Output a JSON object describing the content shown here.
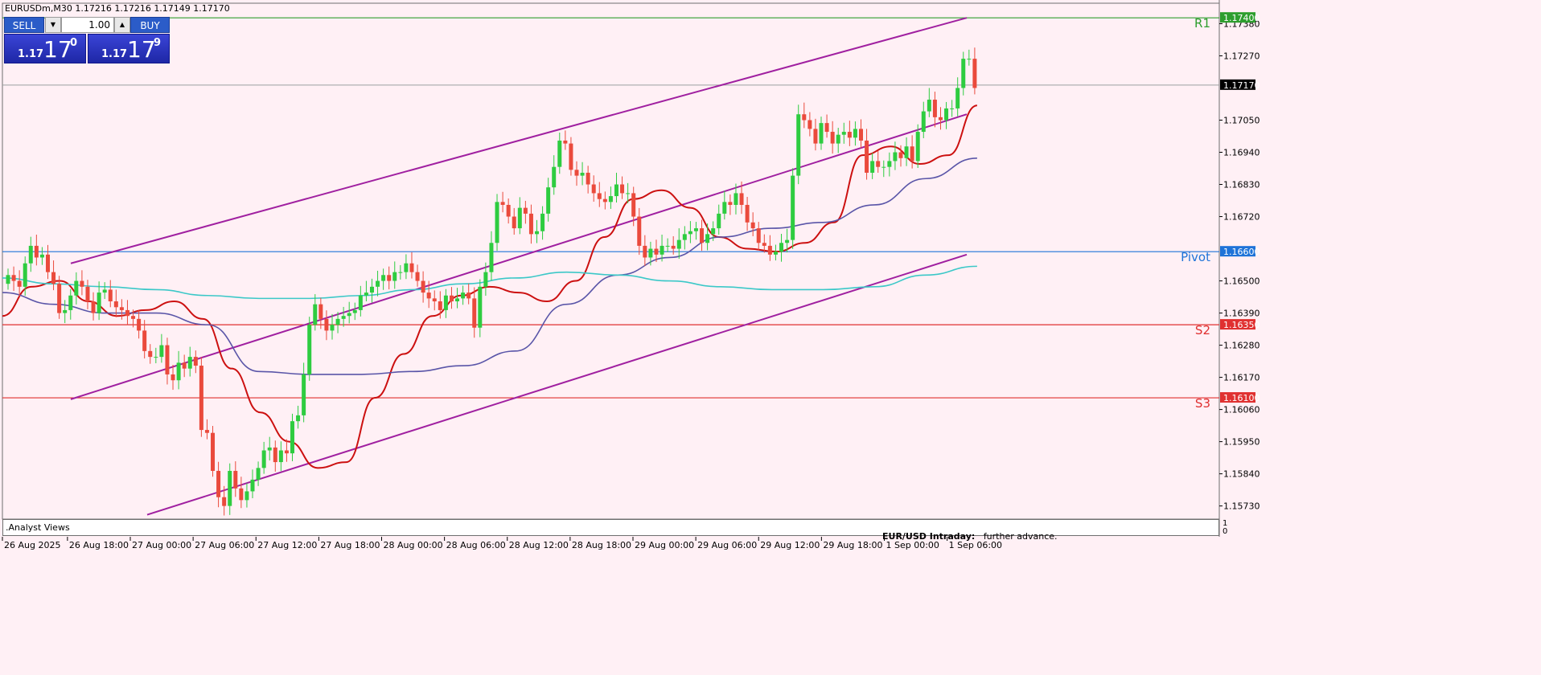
{
  "window": {
    "title": "EURUSDm,M30  1.17216 1.17216 1.17149 1.17170"
  },
  "trade_panel": {
    "sell_label": "SELL",
    "buy_label": "BUY",
    "lot_value": "1.00",
    "sell_price_small": "1.17",
    "sell_price_big": "17",
    "sell_price_sup": "0",
    "buy_price_small": "1.17",
    "buy_price_big": "17",
    "buy_price_sup": "9",
    "sell_color": "#2b5cc8",
    "quote_color": "#2a35c0"
  },
  "subwindow": {
    "label": ".Analyst Views",
    "scale_top": "1",
    "scale_bottom": "0",
    "news_title": "EUR/USD Intraday:",
    "news_text": "further advance."
  },
  "chart_data": {
    "type": "candlestick",
    "symbol": "EURUSDm",
    "timeframe": "M30",
    "ylim": [
      1.1568,
      1.1745
    ],
    "y_ticks": [
      "1.17380",
      "1.17270",
      "1.17050",
      "1.16940",
      "1.16830",
      "1.16720",
      "1.16500",
      "1.16390",
      "1.16280",
      "1.16170",
      "1.16060",
      "1.15950",
      "1.15840",
      "1.15730"
    ],
    "x_ticks": [
      "26 Aug 2025",
      "26 Aug 18:00",
      "27 Aug 00:00",
      "27 Aug 06:00",
      "27 Aug 12:00",
      "27 Aug 18:00",
      "28 Aug 00:00",
      "28 Aug 06:00",
      "28 Aug 12:00",
      "28 Aug 18:00",
      "29 Aug 00:00",
      "29 Aug 06:00",
      "29 Aug 12:00",
      "29 Aug 18:00",
      "1 Sep 00:00",
      "1 Sep 06:00"
    ],
    "levels": [
      {
        "name": "R1",
        "value": 1.174,
        "tag": "1.17400",
        "color": "#2e9e2e"
      },
      {
        "name": "Pivot",
        "value": 1.166,
        "tag": "1.16600",
        "color": "#1e73d8"
      },
      {
        "name": "S2",
        "value": 1.1635,
        "tag": "1.16350",
        "color": "#e03030"
      },
      {
        "name": "S3",
        "value": 1.161,
        "tag": "1.16100",
        "color": "#e03030"
      }
    ],
    "bid": {
      "value": 1.1717,
      "tag": "1.17170"
    },
    "close": [
      1.1652,
      1.165,
      1.1648,
      1.1656,
      1.1662,
      1.1658,
      1.1659,
      1.1653,
      1.1649,
      1.1639,
      1.164,
      1.1645,
      1.165,
      1.1648,
      1.1643,
      1.1639,
      1.1646,
      1.1647,
      1.1643,
      1.1641,
      1.164,
      1.1638,
      1.1637,
      1.1633,
      1.1626,
      1.1624,
      1.1624,
      1.1628,
      1.1618,
      1.1616,
      1.1622,
      1.162,
      1.1624,
      1.1621,
      1.1599,
      1.1598,
      1.1585,
      1.1576,
      1.1573,
      1.1585,
      1.1579,
      1.1575,
      1.1578,
      1.1582,
      1.1586,
      1.1592,
      1.1593,
      1.1588,
      1.1592,
      1.1591,
      1.1602,
      1.1604,
      1.1618,
      1.1635,
      1.1642,
      1.1637,
      1.1633,
      1.1635,
      1.1637,
      1.1638,
      1.1639,
      1.164,
      1.1645,
      1.1646,
      1.1648,
      1.165,
      1.1652,
      1.165,
      1.1653,
      1.1653,
      1.1656,
      1.1653,
      1.165,
      1.1646,
      1.1644,
      1.1643,
      1.164,
      1.1645,
      1.1643,
      1.1644,
      1.1646,
      1.1644,
      1.1634,
      1.1648,
      1.1653,
      1.1663,
      1.1677,
      1.1676,
      1.1672,
      1.1668,
      1.1675,
      1.1673,
      1.1666,
      1.1667,
      1.1673,
      1.1682,
      1.1689,
      1.1698,
      1.1697,
      1.1688,
      1.1686,
      1.1687,
      1.1683,
      1.168,
      1.1678,
      1.1677,
      1.1679,
      1.1683,
      1.168,
      1.168,
      1.1672,
      1.1662,
      1.1658,
      1.1661,
      1.1659,
      1.1662,
      1.1662,
      1.1661,
      1.1664,
      1.1666,
      1.1667,
      1.1668,
      1.1663,
      1.1666,
      1.1668,
      1.1673,
      1.1677,
      1.1676,
      1.168,
      1.1676,
      1.167,
      1.1668,
      1.1663,
      1.1662,
      1.1659,
      1.166,
      1.1663,
      1.1664,
      1.1686,
      1.1707,
      1.1705,
      1.1702,
      1.1697,
      1.1704,
      1.1701,
      1.1697,
      1.17,
      1.1701,
      1.1699,
      1.1702,
      1.1698,
      1.1687,
      1.1691,
      1.1689,
      1.1689,
      1.1691,
      1.1694,
      1.1692,
      1.1696,
      1.1691,
      1.1701,
      1.1708,
      1.1712,
      1.1706,
      1.1705,
      1.1709,
      1.1709,
      1.1716,
      1.1726,
      1.1726,
      1.1716
    ],
    "series": [
      {
        "name": "MA fast",
        "color": "#cc1010",
        "values": [
          1.1638,
          1.1648,
          1.165,
          1.1643,
          1.1638,
          1.164,
          1.1643,
          1.1637,
          1.162,
          1.1605,
          1.1595,
          1.1586,
          1.1588,
          1.161,
          1.1625,
          1.1638,
          1.1645,
          1.1648,
          1.1646,
          1.1643,
          1.165,
          1.1665,
          1.1678,
          1.1681,
          1.1675,
          1.1665,
          1.1661,
          1.166,
          1.1663,
          1.167,
          1.1693,
          1.1696,
          1.169,
          1.1693,
          1.171
        ]
      },
      {
        "name": "MA medium",
        "color": "#5a55a8",
        "values": [
          1.1646,
          1.1642,
          1.1639,
          1.1639,
          1.1635,
          1.1619,
          1.1618,
          1.1618,
          1.1619,
          1.1621,
          1.1626,
          1.1642,
          1.1652,
          1.1658,
          1.1665,
          1.1668,
          1.167,
          1.1676,
          1.1685,
          1.1692
        ]
      },
      {
        "name": "MA slow",
        "color": "#3cc8c8",
        "values": [
          1.1651,
          1.1649,
          1.1648,
          1.1647,
          1.1645,
          1.1644,
          1.1644,
          1.1645,
          1.1647,
          1.1649,
          1.1651,
          1.1653,
          1.1652,
          1.165,
          1.1648,
          1.1647,
          1.1647,
          1.1648,
          1.1652,
          1.1655
        ]
      }
    ],
    "channel": {
      "color": "#a020a0",
      "upper": [
        [
          1.1656,
          1.174
        ]
      ],
      "middle": [
        [
          1.16095,
          1.1707
        ]
      ],
      "lower": [
        [
          1.157,
          1.1659
        ]
      ]
    }
  }
}
